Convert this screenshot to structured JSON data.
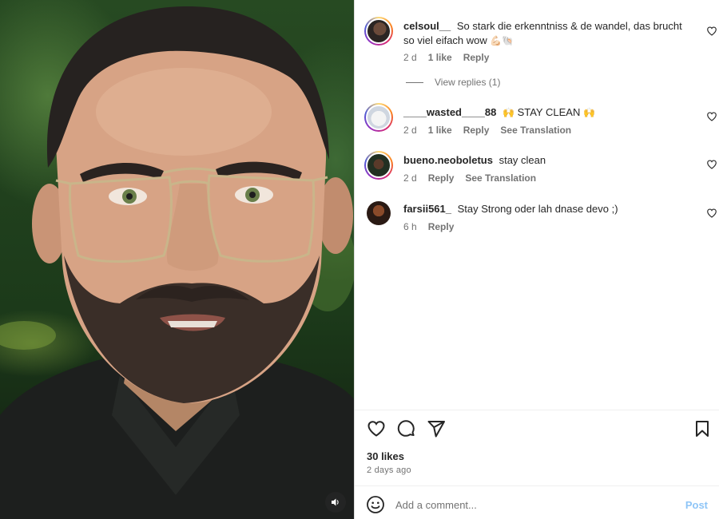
{
  "media": {
    "mute_icon": "speaker-icon"
  },
  "comments": [
    {
      "username": "celsoul__",
      "text": "So stark die erkenntniss & de wandel, das brucht so viel eifach wow",
      "emoji": "💪🏻🐚",
      "time": "2 d",
      "likes": "1 like",
      "reply": "Reply",
      "translation": ""
    },
    {
      "username": "____wasted____88",
      "emoji_before": "🙌",
      "text": "STAY CLEAN",
      "emoji": "🙌",
      "time": "2 d",
      "likes": "1 like",
      "reply": "Reply",
      "translation": "See Translation"
    },
    {
      "username": "bueno.neoboletus",
      "text": "stay clean",
      "emoji": "",
      "time": "2 d",
      "likes": "",
      "reply": "Reply",
      "translation": "See Translation"
    },
    {
      "username": "farsii561_",
      "text": "Stay Strong oder lah dnase devo ;)",
      "emoji": "",
      "time": "6 h",
      "likes": "",
      "reply": "Reply",
      "translation": ""
    }
  ],
  "view_replies": "View replies (1)",
  "post_info": {
    "likes": "30 likes",
    "time_ago": "2 days ago"
  },
  "comment_box": {
    "placeholder": "Add a comment...",
    "post_label": "Post"
  },
  "colors": {
    "text": "#262626",
    "muted": "#737373",
    "post_button": "#8ec5f7",
    "divider": "#dbdbdb"
  }
}
